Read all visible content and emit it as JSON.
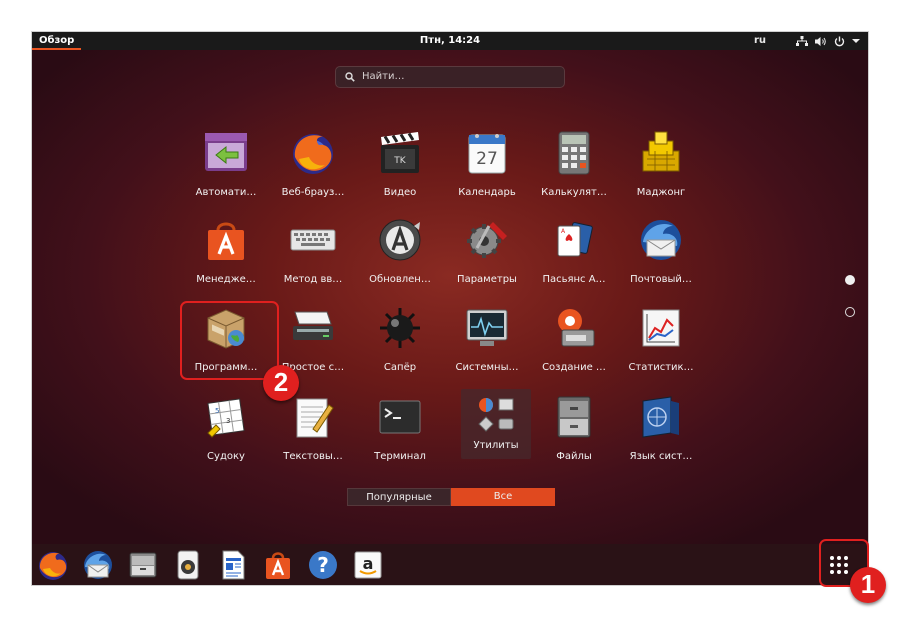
{
  "topbar": {
    "activities": "Обзор",
    "clock": "Птн, 14:24",
    "language": "ru",
    "tray_icons": [
      "network-icon",
      "volume-icon",
      "power-icon",
      "chevron-down-icon"
    ]
  },
  "search": {
    "placeholder": "Найти…"
  },
  "apps": [
    {
      "label": "Автомати…",
      "icon": "automation-icon"
    },
    {
      "label": "Веб-брауз…",
      "icon": "firefox-icon"
    },
    {
      "label": "Видео",
      "icon": "video-icon"
    },
    {
      "label": "Календарь",
      "icon": "calendar-icon",
      "day": "27"
    },
    {
      "label": "Калькулят…",
      "icon": "calculator-icon"
    },
    {
      "label": "Маджонг",
      "icon": "mahjong-icon"
    },
    {
      "label": "Менедже…",
      "icon": "software-center-icon"
    },
    {
      "label": "Метод вв…",
      "icon": "keyboard-icon"
    },
    {
      "label": "Обновлен…",
      "icon": "update-icon"
    },
    {
      "label": "Параметры",
      "icon": "settings-icon"
    },
    {
      "label": "Пасьянс А…",
      "icon": "cards-icon"
    },
    {
      "label": "Почтовый…",
      "icon": "thunderbird-icon"
    },
    {
      "label": "Программ…",
      "icon": "package-icon"
    },
    {
      "label": "Простое с…",
      "icon": "scanner-icon"
    },
    {
      "label": "Сапёр",
      "icon": "mines-icon"
    },
    {
      "label": "Системны…",
      "icon": "system-monitor-icon"
    },
    {
      "label": "Создание …",
      "icon": "startup-disk-icon"
    },
    {
      "label": "Статистик…",
      "icon": "statistics-icon"
    },
    {
      "label": "Судоку",
      "icon": "sudoku-icon"
    },
    {
      "label": "Текстовы…",
      "icon": "text-editor-icon"
    },
    {
      "label": "Терминал",
      "icon": "terminal-icon"
    },
    {
      "label": "Утилиты",
      "icon": "utilities-folder-icon"
    },
    {
      "label": "Файлы",
      "icon": "files-icon"
    },
    {
      "label": "Язык сист…",
      "icon": "language-icon"
    }
  ],
  "switcher": {
    "popular": "Популярные",
    "all": "Все",
    "active": "all"
  },
  "pages": {
    "current": 1,
    "total": 2
  },
  "dock": [
    "firefox-icon",
    "thunderbird-icon",
    "files-icon",
    "rhythmbox-icon",
    "writer-icon",
    "software-center-icon",
    "help-icon",
    "amazon-icon"
  ],
  "annotations": {
    "first": "1",
    "second": "2"
  },
  "colors": {
    "accent": "#e95420",
    "annotation": "#e0201f"
  }
}
